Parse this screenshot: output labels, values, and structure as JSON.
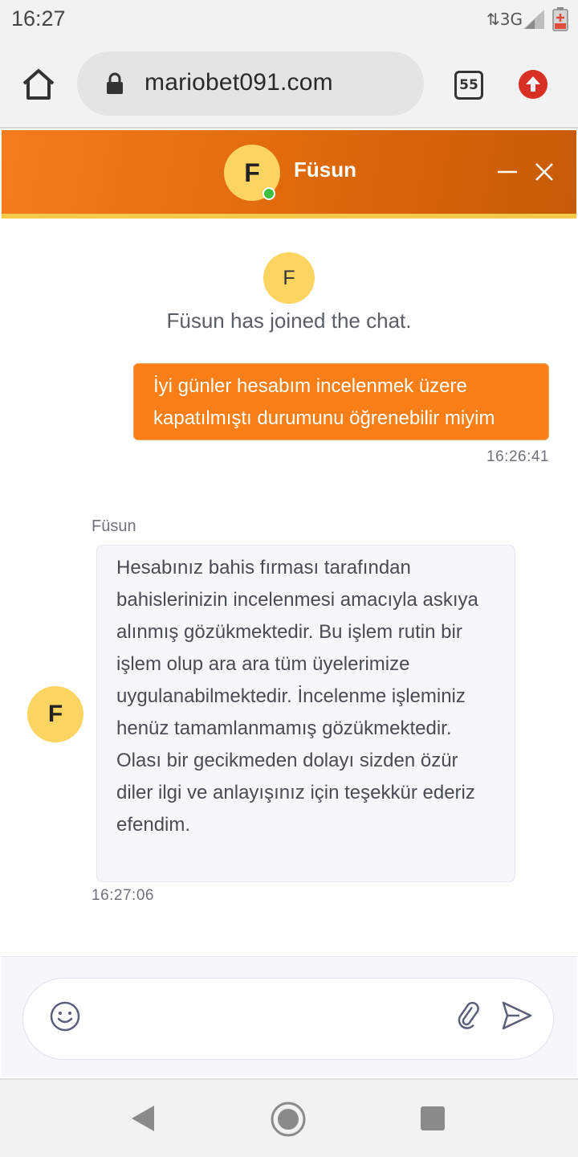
{
  "status_bar": {
    "time": "16:27",
    "network": "3G",
    "icons": [
      "signal-icon",
      "battery-icon"
    ]
  },
  "browser": {
    "url": "mariobet091.com",
    "tab_count": "55",
    "icons": [
      "home-icon",
      "lock-icon",
      "tabs-icon",
      "upload-icon"
    ]
  },
  "chat": {
    "header": {
      "agent_initial": "F",
      "agent_name": "Füsun",
      "status": "online",
      "colors": {
        "header_start": "#f57c1e",
        "header_end": "#c75b08",
        "accent_line": "#f5c94a",
        "online": "#3fbf3f"
      }
    },
    "system_event": {
      "avatar_initial": "F",
      "text": "Füsun has joined the chat."
    },
    "messages": [
      {
        "sender": "user",
        "text": "İyi günler hesabım incelenmek üzere kapatılmıştı durumunu öğrenebilir miyim",
        "time": "16:26:41",
        "bubble_color": "#fb7f16"
      },
      {
        "sender": "agent",
        "sender_name": "Füsun",
        "avatar_initial": "F",
        "text": "Hesabınız bahis fırması tarafından bahislerinizin incelenmesi amacıyla askıya alınmış gözükmektedir. Bu işlem rutin bir işlem olup ara ara tüm üyelerimize uygulanabilmektedir. İncelenme işleminiz henüz tamamlanmamış gözükmektedir. Olası bir gecikmeden dolayı sizden özür diler ilgi ve anlayışınız için teşekkür ederiz efendim.",
        "time": "16:27:06",
        "bubble_color": "#f6f7fb"
      }
    ],
    "composer": {
      "value": "",
      "placeholder": "",
      "icons": [
        "emoji-icon",
        "attach-icon",
        "send-icon"
      ]
    }
  },
  "nav_bar": {
    "icons": [
      "back-icon",
      "home-nav-icon",
      "recents-icon"
    ]
  }
}
